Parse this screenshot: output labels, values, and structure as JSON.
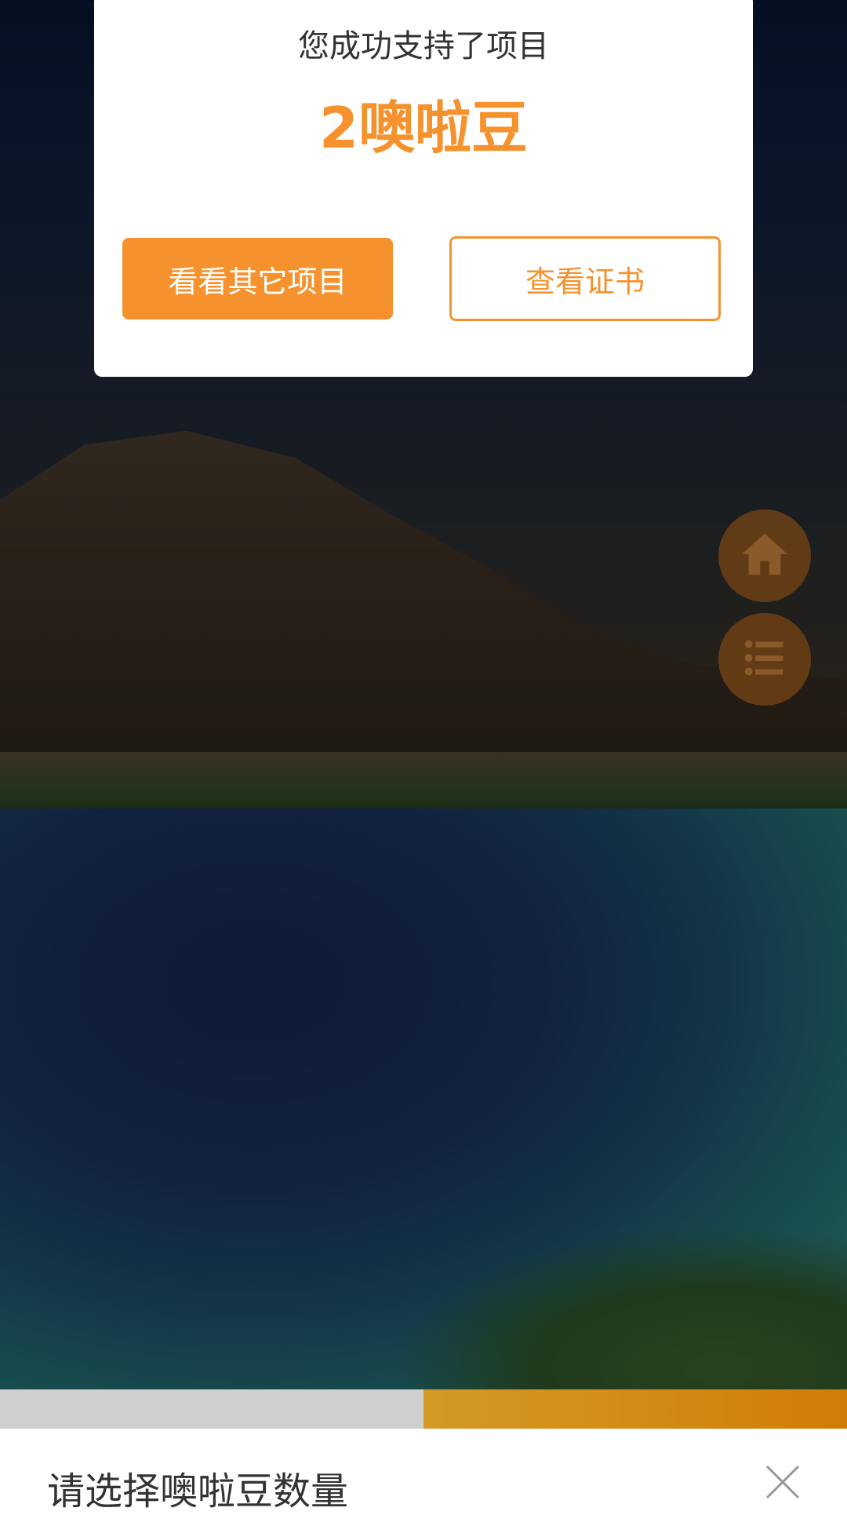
{
  "success": {
    "title": "您成功支持了项目",
    "amount": "2噢啦豆",
    "primary_button": "看看其它项目",
    "secondary_button": "查看证书"
  },
  "floating_actions": {
    "home": {
      "icon": "home-icon"
    },
    "list": {
      "icon": "list-icon"
    }
  },
  "sheet": {
    "title": "请选择噢啦豆数量",
    "close_icon": "close-icon"
  },
  "colors": {
    "accent": "#f5922e",
    "fab_bg": "#7a4614",
    "bar_left": "#cfcfcf",
    "bar_right": "#d08000"
  }
}
